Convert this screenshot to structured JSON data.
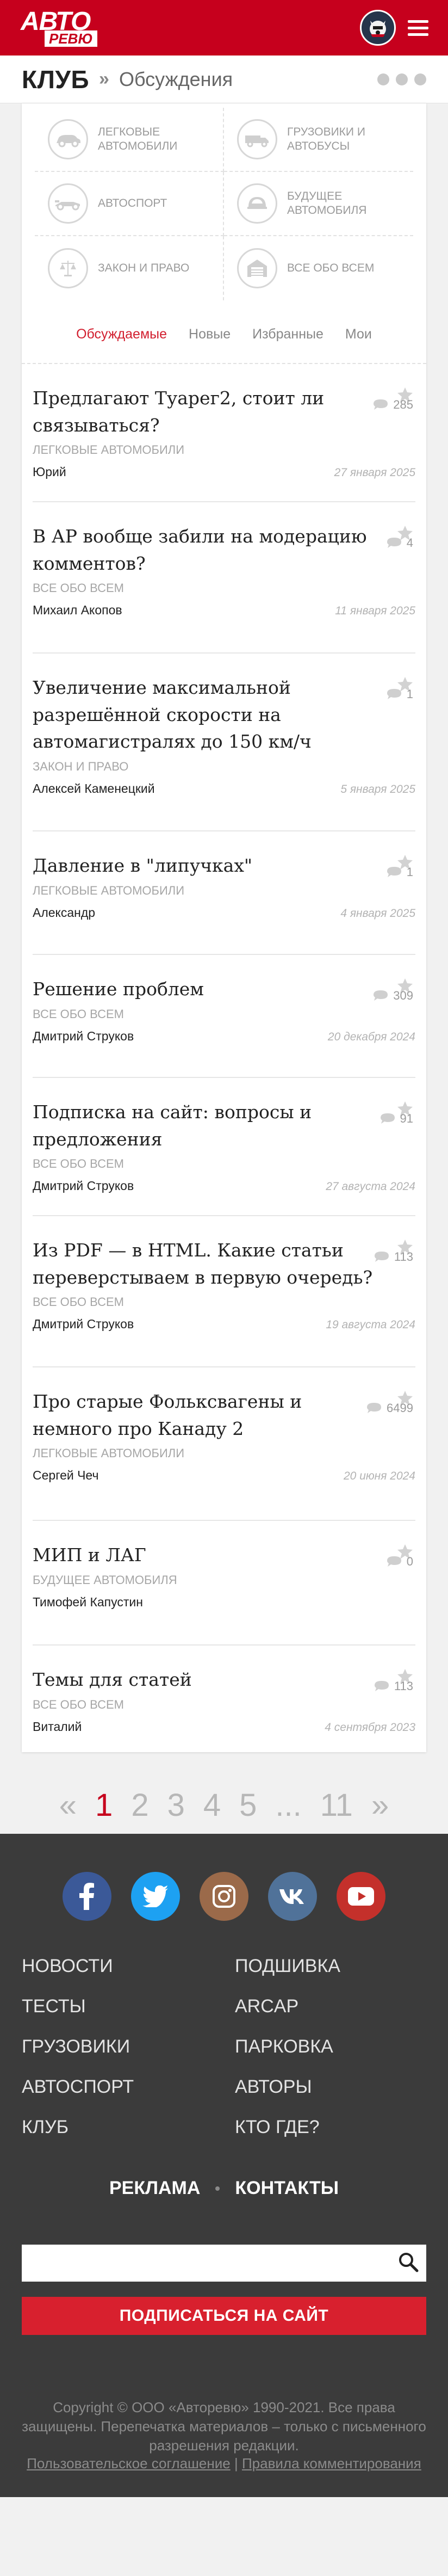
{
  "header": {
    "logo_top": "АВТО",
    "logo_bottom": "РЕВЮ"
  },
  "breadcrumb": {
    "section": "КЛУБ",
    "separator": "»",
    "page": "Обсуждения"
  },
  "categories": [
    {
      "label": "Легковые автомобили",
      "icon": "passenger-car-icon"
    },
    {
      "label": "Грузовики и автобусы",
      "icon": "truck-icon"
    },
    {
      "label": "Автоспорт",
      "icon": "race-car-icon"
    },
    {
      "label": "Будущее автомобиля",
      "icon": "future-car-icon"
    },
    {
      "label": "Закон и право",
      "icon": "scales-icon"
    },
    {
      "label": "Все обо всем",
      "icon": "garage-icon"
    }
  ],
  "tabs": [
    {
      "label": "Обсуждаемые",
      "active": true
    },
    {
      "label": "Новые",
      "active": false
    },
    {
      "label": "Избранные",
      "active": false
    },
    {
      "label": "Мои",
      "active": false
    }
  ],
  "posts": [
    {
      "title": "Предлагают Туарег2, стоит ли связываться?",
      "category": "ЛЕГКОВЫЕ АВТОМОБИЛИ",
      "author": "Юрий",
      "comments": "285",
      "date": "27 января 2025"
    },
    {
      "title": "В АР вообще забили на модерацию комментов?",
      "category": "ВСЕ ОБО ВСЕМ",
      "author": "Михаил Акопов",
      "comments": "4",
      "date": "11 января 2025"
    },
    {
      "title": "Увеличение максимальной разрешённой скорости на автомагистралях до 150 км/ч",
      "category": "ЗАКОН И ПРАВО",
      "author": "Алексей Каменецкий",
      "comments": "1",
      "date": "5 января 2025"
    },
    {
      "title": "Давление в \"липучках\"",
      "category": "ЛЕГКОВЫЕ АВТОМОБИЛИ",
      "author": "Александр",
      "comments": "1",
      "date": "4 января 2025"
    },
    {
      "title": "Решение проблем",
      "category": "ВСЕ ОБО ВСЕМ",
      "author": "Дмитрий Струков",
      "comments": "309",
      "date": "20 декабря 2024"
    },
    {
      "title": "Подписка на сайт: вопросы и предложения",
      "category": "ВСЕ ОБО ВСЕМ",
      "author": "Дмитрий Струков",
      "comments": "91",
      "date": "27 августа 2024"
    },
    {
      "title": "Из PDF — в HTML. Какие статьи переверстываем в первую очередь?",
      "category": "ВСЕ ОБО ВСЕМ",
      "author": "Дмитрий Струков",
      "comments": "113",
      "date": "19 августа 2024"
    },
    {
      "title": "Про старые Фольксвагены и немного про Канаду 2",
      "category": "ЛЕГКОВЫЕ АВТОМОБИЛИ",
      "author": "Сергей Чеч",
      "comments": "6499",
      "date": "20 июня 2024"
    },
    {
      "title": "МИП и ЛАГ",
      "category": "БУДУЩЕЕ АВТОМОБИЛЯ",
      "author": "Тимофей Капустин",
      "comments": "0",
      "date": ""
    },
    {
      "title": "Темы для статей",
      "category": "ВСЕ ОБО ВСЕМ",
      "author": "Виталий",
      "comments": "113",
      "date": "4 сентября 2023"
    }
  ],
  "pagination": [
    "«",
    "1",
    "2",
    "3",
    "4",
    "5",
    "...",
    "11",
    "»"
  ],
  "pagination_current": "1",
  "footer": {
    "socials": [
      {
        "name": "facebook-icon",
        "color": "#3b5998"
      },
      {
        "name": "twitter-icon",
        "color": "#1da1f2"
      },
      {
        "name": "instagram-icon",
        "color": "#9b6a4a"
      },
      {
        "name": "vk-icon",
        "color": "#507299"
      },
      {
        "name": "youtube-icon",
        "color": "#c4302b"
      }
    ],
    "nav": [
      "Новости",
      "Подшивка",
      "Тесты",
      "ARCAP",
      "Грузовики",
      "Парковка",
      "Автоспорт",
      "Авторы",
      "Клуб",
      "Кто где?"
    ],
    "ad_link": "Реклама",
    "contacts_link": "Контакты",
    "search_placeholder": "",
    "subscribe_label": "Подписаться на сайт",
    "copyright": "Copyright © ООО «Авторевю» 1990-2021. Все права защищены. Перепечатка материалов – только с письменного разрешения редакции.",
    "agreement_link": "Пользовательское соглашение",
    "legal_sep": "|",
    "comment_rules_link": "Правила комментирования"
  },
  "colors": {
    "brand_red": "#c6001d",
    "footer_bg": "#3b3b3b"
  }
}
